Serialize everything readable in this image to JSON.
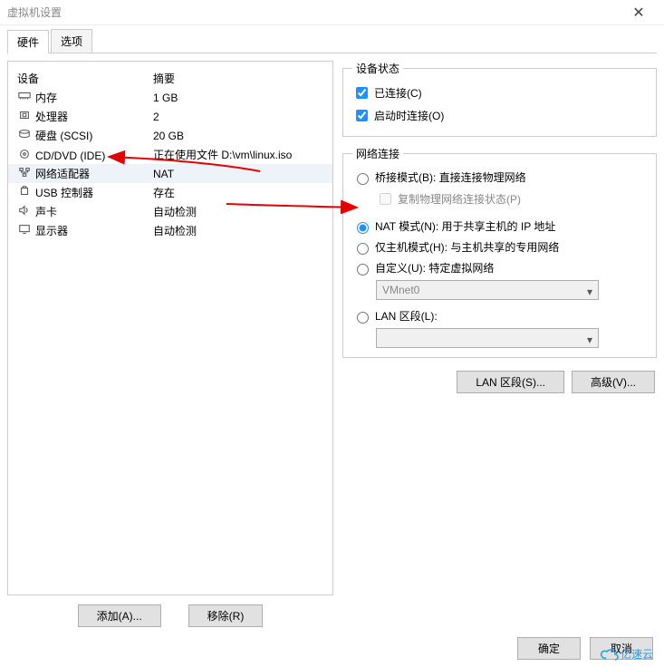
{
  "window": {
    "title": "虚拟机设置"
  },
  "tabs": {
    "hardware": "硬件",
    "options": "选项"
  },
  "columns": {
    "device": "设备",
    "summary": "摘要"
  },
  "devices": [
    {
      "name": "内存",
      "summary": "1 GB"
    },
    {
      "name": "处理器",
      "summary": "2"
    },
    {
      "name": "硬盘 (SCSI)",
      "summary": "20 GB"
    },
    {
      "name": "CD/DVD (IDE)",
      "summary": "正在使用文件 D:\\vm\\linux.iso"
    },
    {
      "name": "网络适配器",
      "summary": "NAT"
    },
    {
      "name": "USB 控制器",
      "summary": "存在"
    },
    {
      "name": "声卡",
      "summary": "自动检测"
    },
    {
      "name": "显示器",
      "summary": "自动检测"
    }
  ],
  "buttons": {
    "add": "添加(A)...",
    "remove": "移除(R)",
    "lanseg": "LAN 区段(S)...",
    "advanced": "高级(V)...",
    "ok": "确定",
    "cancel": "取消"
  },
  "status": {
    "legend": "设备状态",
    "connected": "已连接(C)",
    "connectOnStart": "启动时连接(O)"
  },
  "net": {
    "legend": "网络连接",
    "bridge": "桥接模式(B): 直接连接物理网络",
    "replicate": "复制物理网络连接状态(P)",
    "nat": "NAT 模式(N): 用于共享主机的 IP 地址",
    "hostonly": "仅主机模式(H): 与主机共享的专用网络",
    "custom": "自定义(U): 特定虚拟网络",
    "vnet_value": "VMnet0",
    "lan": "LAN 区段(L):",
    "lan_value": ""
  },
  "brand": "亿速云"
}
